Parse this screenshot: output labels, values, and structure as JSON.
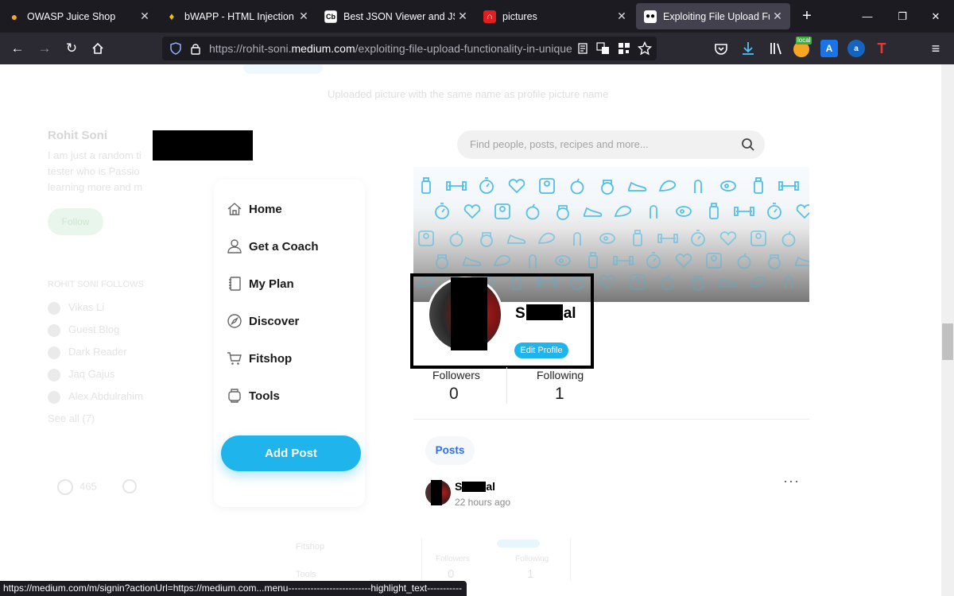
{
  "browser": {
    "tabs": [
      {
        "label": "OWASP Juice Shop",
        "icon": "juice-shop-favicon",
        "active": false
      },
      {
        "label": "bWAPP - HTML Injection",
        "icon": "bwapp-bee-favicon",
        "active": false
      },
      {
        "label": "Best JSON Viewer and JSON B",
        "icon": "codebeautify-favicon",
        "icon_text": "Cb",
        "active": false
      },
      {
        "label": "pictures",
        "icon": "pictures-favicon",
        "active": false
      },
      {
        "label": "Exploiting File Upload Functio",
        "icon": "medium-favicon",
        "active": true
      }
    ],
    "url_prefix": "https://rohit-soni.",
    "url_domain": "medium.com",
    "url_path": "/exploiting-file-upload-functionality-in-unique-w",
    "ext_local_label": "local",
    "status_url": "https://medium.com/m/signin?actionUrl=https://medium.com...menu--------------------------highlight_text-----------"
  },
  "background_article": {
    "caption": "Uploaded picture with the same name as profile picture name",
    "author_name": "Rohit Soni",
    "bio_lines": [
      "I am just a random ti",
      "tester who is Passio",
      "learning more and m"
    ],
    "follow_label": "Follow",
    "follows_heading": "ROHIT SONI FOLLOWS",
    "follows": [
      "Vikas Li",
      "Guest Blog",
      "Dark Reader",
      "Jaq Gajus",
      "Alex Abdulrahim"
    ],
    "see_all": "See all (7)",
    "claps": "465",
    "lower_nav": [
      "Fitshop",
      "Tools"
    ],
    "lower_stats": [
      {
        "label": "Followers",
        "value": "0"
      },
      {
        "label": "Following",
        "value": "1"
      }
    ]
  },
  "app": {
    "search_placeholder": "Find people, posts, recipes and more...",
    "nav": [
      {
        "label": "Home",
        "icon": "home-icon"
      },
      {
        "label": "Get a Coach",
        "icon": "person-icon"
      },
      {
        "label": "My Plan",
        "icon": "notebook-icon"
      },
      {
        "label": "Discover",
        "icon": "compass-icon"
      },
      {
        "label": "Fitshop",
        "icon": "cart-icon"
      },
      {
        "label": "Tools",
        "icon": "watch-icon"
      }
    ],
    "add_post_label": "Add Post",
    "profile": {
      "name_first": "S",
      "name_last": "al",
      "edit_label": "Edit Profile",
      "followers_label": "Followers",
      "followers_value": "0",
      "following_label": "Following",
      "following_value": "1"
    },
    "posts_tab_label": "Posts",
    "post": {
      "author_first": "S",
      "author_last": "al",
      "time": "22 hours ago",
      "more_label": "···"
    }
  },
  "colors": {
    "accent": "#1fb5ec",
    "posts_tab_text": "#2f6fe0",
    "icon_pattern": "#3cb8e6",
    "chrome_dark": "#1c1b22",
    "chrome_mid": "#2b2a33"
  }
}
